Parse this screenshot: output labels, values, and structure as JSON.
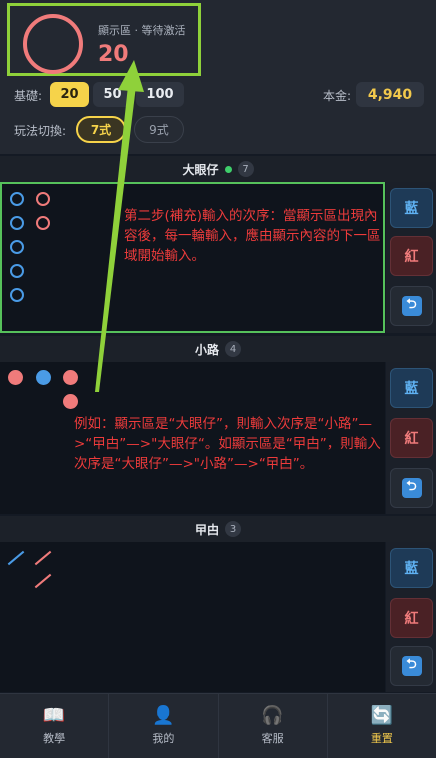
{
  "display": {
    "label": "顯示區 · 等待激活",
    "value": "20"
  },
  "base": {
    "label": "基礎:",
    "options": [
      "20",
      "50",
      "100"
    ],
    "selected": "20"
  },
  "balance": {
    "label": "本金:",
    "value": "4,940"
  },
  "mode": {
    "label": "玩法切換:",
    "options": [
      "7式",
      "9式"
    ],
    "selected": "7式"
  },
  "sections": [
    {
      "title": "大眼仔",
      "count": "7"
    },
    {
      "title": "小路",
      "count": "4"
    },
    {
      "title": "曱甴",
      "count": "3"
    }
  ],
  "side_buttons": {
    "blue": "藍",
    "red": "紅",
    "undo_icon": "undo-icon"
  },
  "annotations": {
    "step2": "第二步(補充)輸入的次序：當顯示區出現內容後，每一輪輸入，應由顯示內容的下一區域開始輸入。",
    "example": "例如：顯示區是“大眼仔”，則輸入次序是“小路”—>“曱甴”—>\"大眼仔“。如顯示區是“曱甴”，則輸入次序是“大眼仔”—>\"小路”—>“曱甴”。"
  },
  "nav": [
    {
      "label": "教學",
      "icon": "book-icon"
    },
    {
      "label": "我的",
      "icon": "user-icon"
    },
    {
      "label": "客服",
      "icon": "headset-icon"
    },
    {
      "label": "重置",
      "icon": "reset-icon"
    }
  ],
  "colors": {
    "accent_green": "#8fd13a",
    "red": "#f07b7b",
    "blue": "#4a9be6",
    "gold": "#f6d34a",
    "annotation": "#ec3b3b"
  }
}
